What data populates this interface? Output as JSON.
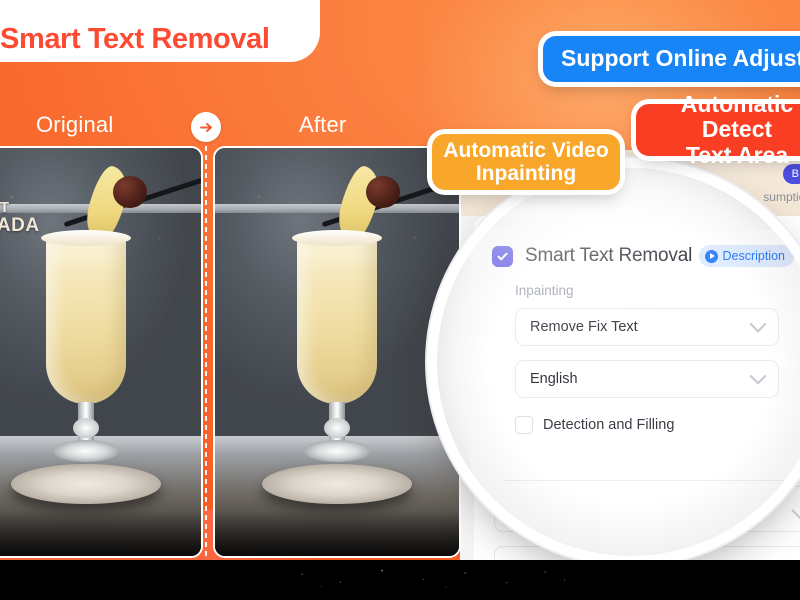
{
  "header": {
    "title": "Smart Text Removal"
  },
  "comparison": {
    "original_label": "Original",
    "after_label": "After",
    "arrow_icon": "arrow-right-icon",
    "original_overlay_line1": "PERFECT",
    "original_overlay_line2": "A COLADA"
  },
  "badges": [
    {
      "id": "support-online-adjustment",
      "label": "Support Online Adjustment",
      "color": "#1785F6"
    },
    {
      "id": "automatic-detect-text-area",
      "line1": "Automatic Detect",
      "line2": "Text Area",
      "color": "#F93E24"
    },
    {
      "id": "automatic-video-inpainting",
      "line1": "Automatic Video",
      "line2": "Inpainting",
      "color": "#F9A72B"
    }
  ],
  "panel": {
    "feature_checkbox_checked": true,
    "feature_title": "Smart Text Removal",
    "description_pill": {
      "label": "Description",
      "icon": "play-circle-icon",
      "color": "#2D7FF9"
    },
    "section_label": "Inpainting",
    "selects": [
      {
        "id": "inpainting-mode",
        "value": "Remove Fix Text",
        "chevron": "chevron-down-icon"
      },
      {
        "id": "language",
        "value": "English",
        "chevron": "chevron-down-icon"
      }
    ],
    "detection_checkbox": {
      "label": "Detection and Filling",
      "checked": false
    }
  },
  "background_app": {
    "badge_label": "B",
    "partial_text": "sumption"
  },
  "colors": {
    "background_orange": "#F96B2E",
    "title_red": "#FC4B32",
    "accent_indigo": "#5B54E8",
    "accent_blue": "#2D7FF9"
  }
}
